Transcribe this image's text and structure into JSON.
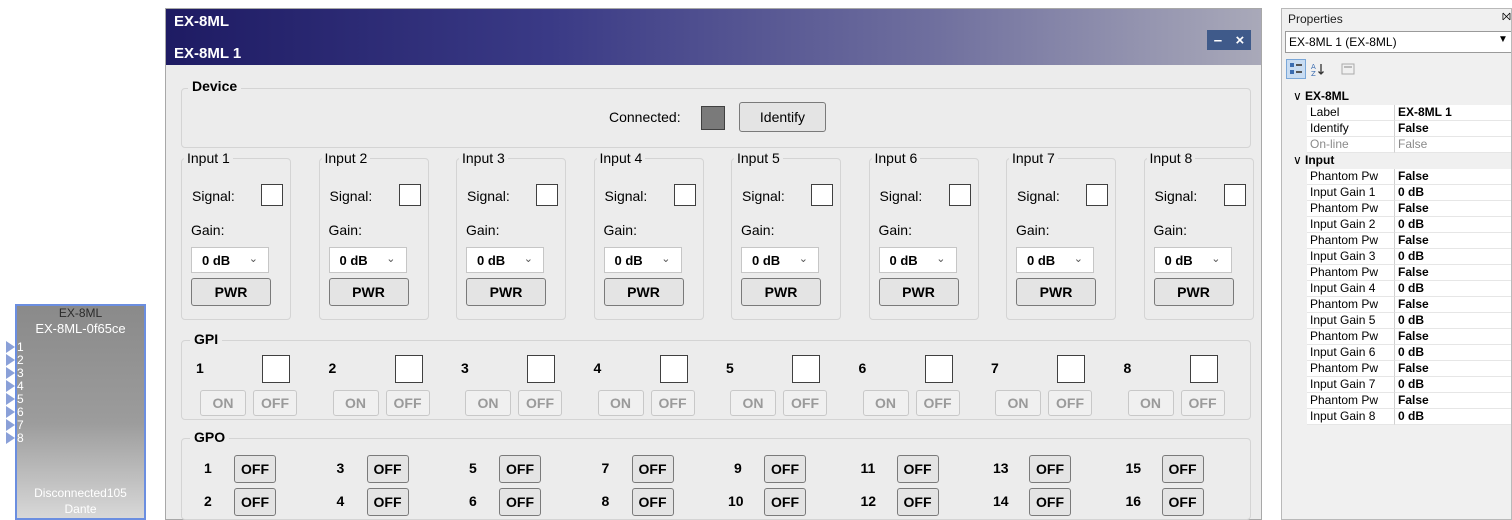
{
  "block": {
    "title": "EX-8ML",
    "subtitle": "EX-8ML-0f65ce",
    "pins": [
      "1",
      "2",
      "3",
      "4",
      "5",
      "6",
      "7",
      "8"
    ],
    "footer1": "Disconnected105",
    "footer2": "Dante"
  },
  "window": {
    "title": "EX-8ML",
    "subtitle": "EX-8ML 1",
    "minimize": "–",
    "close": "×"
  },
  "device": {
    "label": "Device",
    "connected_label": "Connected:",
    "identify_label": "Identify"
  },
  "inputs": [
    {
      "label": "Input 1",
      "signal": "Signal:",
      "gain_label": "Gain:",
      "gain": "0 dB",
      "pwr": "PWR"
    },
    {
      "label": "Input 2",
      "signal": "Signal:",
      "gain_label": "Gain:",
      "gain": "0 dB",
      "pwr": "PWR"
    },
    {
      "label": "Input 3",
      "signal": "Signal:",
      "gain_label": "Gain:",
      "gain": "0 dB",
      "pwr": "PWR"
    },
    {
      "label": "Input 4",
      "signal": "Signal:",
      "gain_label": "Gain:",
      "gain": "0 dB",
      "pwr": "PWR"
    },
    {
      "label": "Input 5",
      "signal": "Signal:",
      "gain_label": "Gain:",
      "gain": "0 dB",
      "pwr": "PWR"
    },
    {
      "label": "Input 6",
      "signal": "Signal:",
      "gain_label": "Gain:",
      "gain": "0 dB",
      "pwr": "PWR"
    },
    {
      "label": "Input 7",
      "signal": "Signal:",
      "gain_label": "Gain:",
      "gain": "0 dB",
      "pwr": "PWR"
    },
    {
      "label": "Input 8",
      "signal": "Signal:",
      "gain_label": "Gain:",
      "gain": "0 dB",
      "pwr": "PWR"
    }
  ],
  "gpi": {
    "label": "GPI",
    "channels": [
      "1",
      "2",
      "3",
      "4",
      "5",
      "6",
      "7",
      "8"
    ],
    "on_label": "ON",
    "off_label": "OFF"
  },
  "gpo": {
    "label": "GPO",
    "channels": [
      "1",
      "2",
      "3",
      "4",
      "5",
      "6",
      "7",
      "8",
      "9",
      "10",
      "11",
      "12",
      "13",
      "14",
      "15",
      "16"
    ],
    "off_label": "OFF"
  },
  "props": {
    "title": "Properties",
    "pin": "⨝",
    "selected": "EX-8ML 1 (EX-8ML)",
    "categories": [
      {
        "name": "EX-8ML",
        "rows": [
          {
            "key": "Label",
            "value": "EX-8ML 1",
            "readonly": false
          },
          {
            "key": "Identify",
            "value": "False",
            "readonly": false
          },
          {
            "key": "On-line",
            "value": "False",
            "readonly": true
          }
        ]
      },
      {
        "name": "Input",
        "rows": [
          {
            "key": "Phantom Pw",
            "value": "False",
            "readonly": false
          },
          {
            "key": "Input Gain 1",
            "value": "0 dB",
            "readonly": false
          },
          {
            "key": "Phantom Pw",
            "value": "False",
            "readonly": false
          },
          {
            "key": "Input Gain 2",
            "value": "0 dB",
            "readonly": false
          },
          {
            "key": "Phantom Pw",
            "value": "False",
            "readonly": false
          },
          {
            "key": "Input Gain 3",
            "value": "0 dB",
            "readonly": false
          },
          {
            "key": "Phantom Pw",
            "value": "False",
            "readonly": false
          },
          {
            "key": "Input Gain 4",
            "value": "0 dB",
            "readonly": false
          },
          {
            "key": "Phantom Pw",
            "value": "False",
            "readonly": false
          },
          {
            "key": "Input Gain 5",
            "value": "0 dB",
            "readonly": false
          },
          {
            "key": "Phantom Pw",
            "value": "False",
            "readonly": false
          },
          {
            "key": "Input Gain 6",
            "value": "0 dB",
            "readonly": false
          },
          {
            "key": "Phantom Pw",
            "value": "False",
            "readonly": false
          },
          {
            "key": "Input Gain 7",
            "value": "0 dB",
            "readonly": false
          },
          {
            "key": "Phantom Pw",
            "value": "False",
            "readonly": false
          },
          {
            "key": "Input Gain 8",
            "value": "0 dB",
            "readonly": false
          }
        ]
      }
    ]
  },
  "colors": {
    "connected_indicator": "#7a7a7a",
    "titlebar_start": "#1e1b63",
    "titlebar_end": "#a9a9b9",
    "block_border": "#6b8ee0"
  }
}
